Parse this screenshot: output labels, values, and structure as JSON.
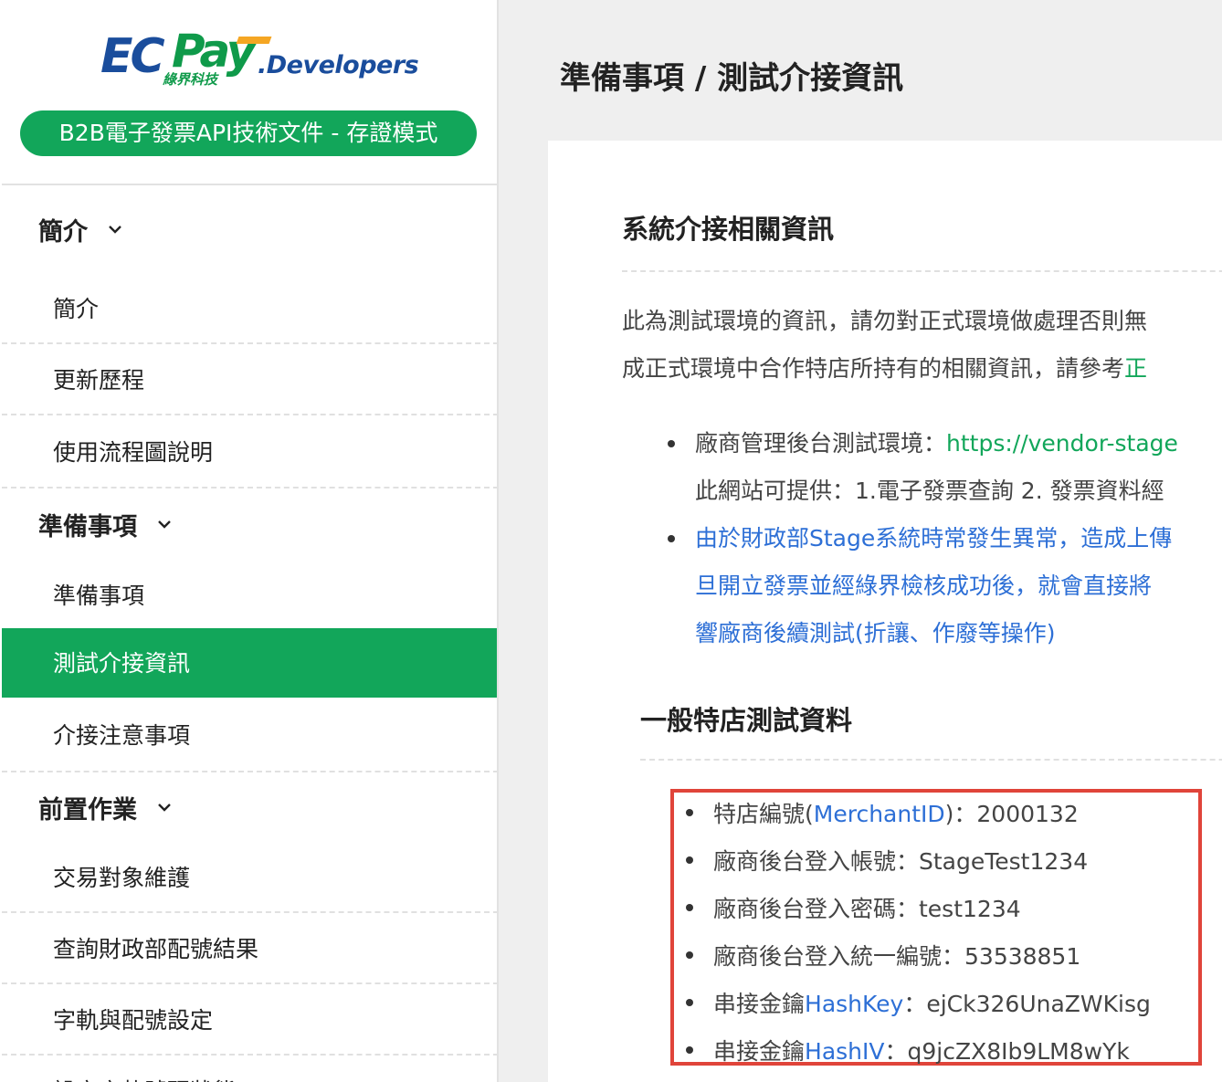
{
  "sidebar": {
    "logo": {
      "brand_ec": "EC",
      "brand_pay": "Pay",
      "brand_cn": "綠界科技",
      "developers": ".Developers"
    },
    "doc_badge": "B2B電子發票API技術文件 - 存證模式",
    "groups": [
      {
        "label": "簡介",
        "items": [
          "簡介",
          "更新歷程",
          "使用流程圖說明"
        ]
      },
      {
        "label": "準備事項",
        "items": [
          "準備事項",
          "測試介接資訊",
          "介接注意事項"
        ]
      },
      {
        "label": "前置作業",
        "items": [
          "交易對象維護",
          "查詢財政部配號結果",
          "字軌與配號設定",
          "設定字軌號碼狀態"
        ]
      }
    ],
    "active_item": "測試介接資訊"
  },
  "header": {
    "title": "準備事項 / 測試介接資訊"
  },
  "main": {
    "section_title": "系統介接相關資訊",
    "intro_line1": "此為測試環境的資訊，請勿對正式環境做處理否則無",
    "intro_line2_text": "成正式環境中合作特店所持有的相關資訊，請參考",
    "intro_line2_link": "正",
    "bullet1_label": "廠商管理後台測試環境：",
    "bullet1_link": "https://vendor-stage",
    "bullet1_line2": "此網站可提供：1.電子發票查詢  2. 發票資料經",
    "bullet2_line1": "由於財政部Stage系統時常發生異常，造成上傳",
    "bullet2_line2": "旦開立發票並經綠界檢核成功後，就會直接將",
    "bullet2_line3": "響廠商後續測試(折讓、作廢等操作)",
    "subsection_title": "一般特店測試資料",
    "credentials": [
      {
        "label": "特店編號(",
        "link": "MerchantID",
        "suffix": ")：2000132"
      },
      {
        "label": "廠商後台登入帳號：StageTest1234",
        "link": "",
        "suffix": ""
      },
      {
        "label": "廠商後台登入密碼：test1234",
        "link": "",
        "suffix": ""
      },
      {
        "label": "廠商後台登入統一編號：53538851",
        "link": "",
        "suffix": ""
      },
      {
        "label": "串接金鑰",
        "link": "HashKey",
        "suffix": "：ejCk326UnaZWKisg"
      },
      {
        "label": "串接金鑰",
        "link": "HashIV",
        "suffix": "：q9jcZX8Ib9LM8wYk"
      }
    ]
  },
  "colors": {
    "accent_green": "#12a65a",
    "link_blue": "#2d6fd6",
    "highlight_red": "#e0443a",
    "brand_blue": "#1a4d9c",
    "brand_orange": "#f5a623"
  }
}
